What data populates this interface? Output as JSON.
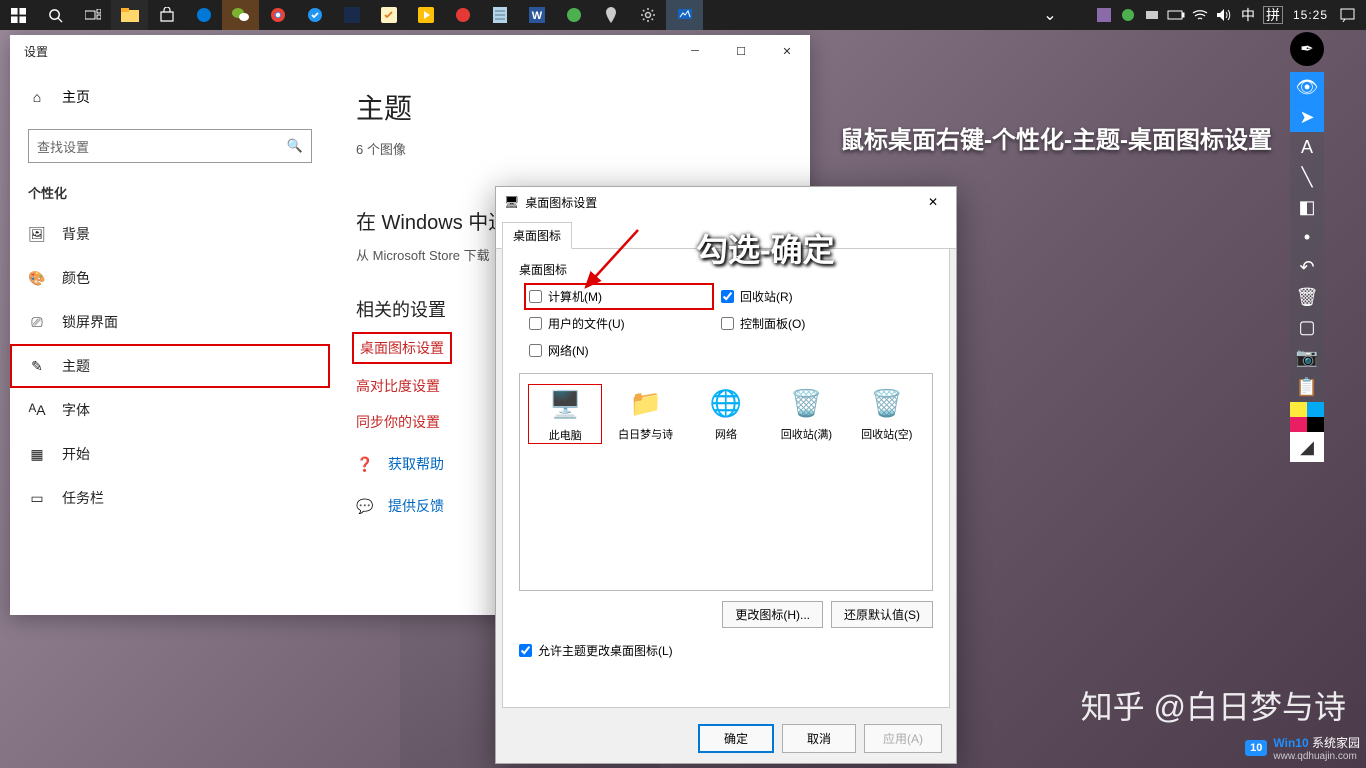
{
  "taskbar": {
    "tray_ime": "中",
    "tray_ime2": "拼",
    "clock": "15:25"
  },
  "settings": {
    "title": "设置",
    "home": "主页",
    "search_placeholder": "查找设置",
    "section": "个性化",
    "nav": {
      "background": "背景",
      "colors": "颜色",
      "lockscreen": "锁屏界面",
      "themes": "主题",
      "fonts": "字体",
      "start": "开始",
      "taskbar": "任务栏"
    },
    "main_title": "主题",
    "image_count": "6 个图像",
    "store_heading": "在 Windows 中进",
    "store_desc": "从 Microsoft Store 下载",
    "related_heading": "相关的设置",
    "links": {
      "desktop_icons": "桌面图标设置",
      "high_contrast": "高对比度设置",
      "sync": "同步你的设置"
    },
    "help": "获取帮助",
    "feedback": "提供反馈"
  },
  "dialog": {
    "title": "桌面图标设置",
    "tab": "桌面图标",
    "group": "桌面图标",
    "checks": {
      "computer": "计算机(M)",
      "recycle": "回收站(R)",
      "user_files": "用户的文件(U)",
      "control_panel": "控制面板(O)",
      "network": "网络(N)"
    },
    "previews": {
      "this_pc": "此电脑",
      "user": "白日梦与诗",
      "network": "网络",
      "recycle_full": "回收站(满)",
      "recycle_empty": "回收站(空)"
    },
    "change_icon": "更改图标(H)...",
    "restore_default": "还原默认值(S)",
    "allow_themes": "允许主题更改桌面图标(L)",
    "ok": "确定",
    "cancel": "取消",
    "apply": "应用(A)"
  },
  "annotations": {
    "top": "鼠标桌面右键-个性化-主题-桌面图标设置",
    "mid": "勾选-确定"
  },
  "watermark": {
    "zhihu": "知乎 @白日梦与诗",
    "badge": "10",
    "brand_a": "Win10",
    "brand_b": "系统家园",
    "url": "www.qdhuajin.com"
  }
}
